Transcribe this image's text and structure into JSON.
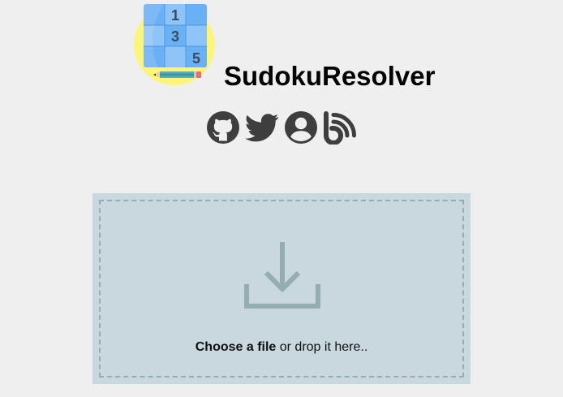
{
  "header": {
    "app_title": "SudokuResolver",
    "logo": {
      "icon": "sudoku-grid-pencil-logo",
      "digits": [
        "1",
        "3",
        "5"
      ]
    }
  },
  "social_links": [
    {
      "icon": "github-icon"
    },
    {
      "icon": "twitter-icon"
    },
    {
      "icon": "user-circle-icon"
    },
    {
      "icon": "blog-icon"
    }
  ],
  "upload": {
    "icon": "download-icon",
    "choose_label": "Choose a file",
    "drop_hint": " or drop it here.."
  },
  "colors": {
    "background": "#efefef",
    "panel": "#c8d8de",
    "dashed_border": "#93adb0",
    "icon_gray": "#3e3e3e",
    "upload_icon": "#93adb0",
    "logo_circle": "#fdf57a",
    "logo_grid": "#6ab0f5"
  }
}
